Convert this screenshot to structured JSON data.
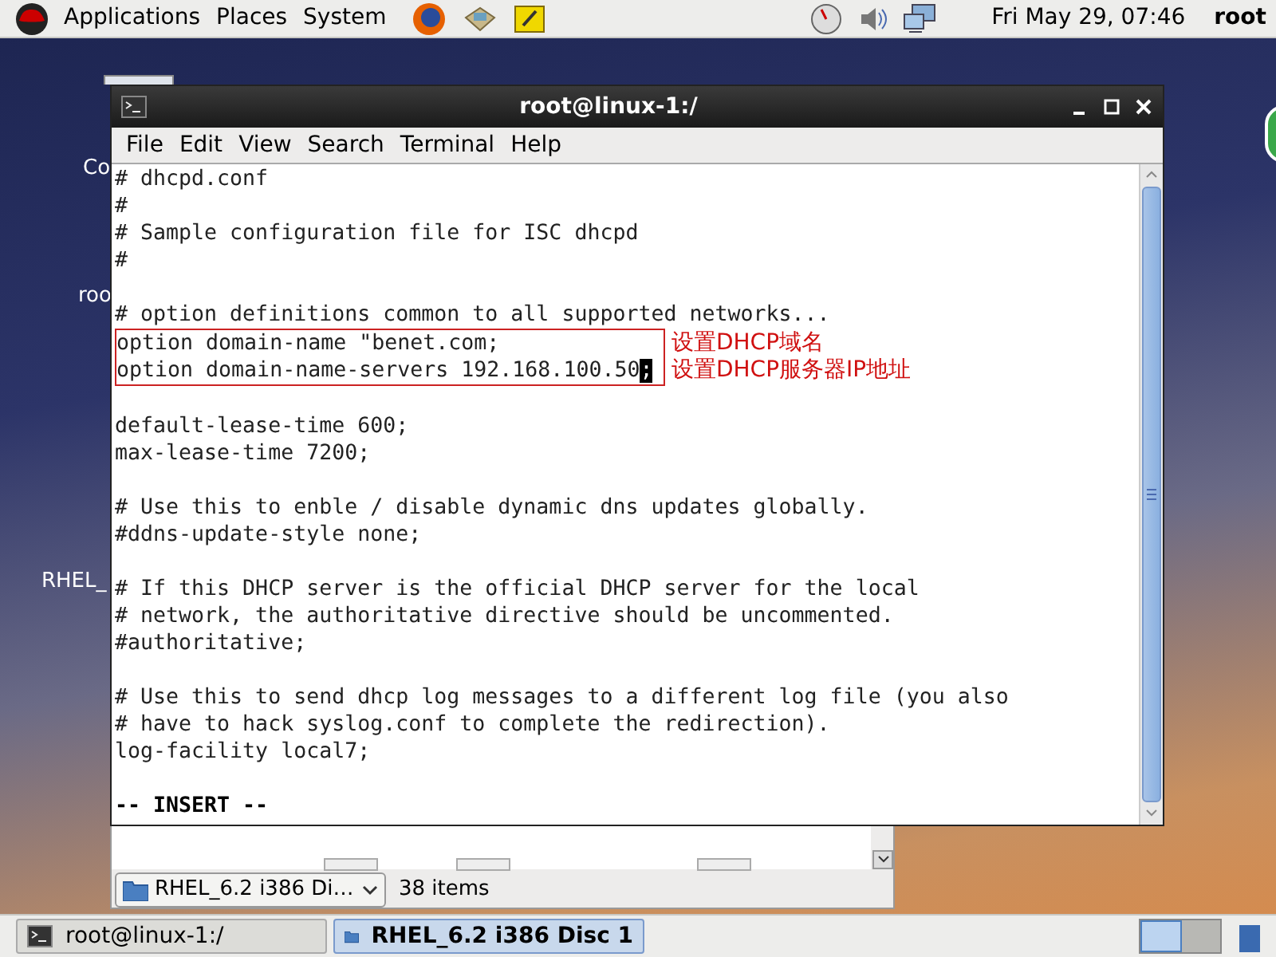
{
  "top_panel": {
    "menus": [
      "Applications",
      "Places",
      "System"
    ],
    "clock": "Fri May 29, 07:46",
    "user": "root"
  },
  "desktop_icons": [
    {
      "label": "Co"
    },
    {
      "label": "roo"
    },
    {
      "label": "RHEL_"
    }
  ],
  "terminal": {
    "title": "root@linux-1:/",
    "menu": [
      "File",
      "Edit",
      "View",
      "Search",
      "Terminal",
      "Help"
    ],
    "blocks": [
      [
        {
          "text": "# dhcpd.conf",
          "highlighted": false
        },
        {
          "text": "#",
          "highlighted": false
        },
        {
          "text": "# Sample configuration file for ISC dhcpd",
          "highlighted": false
        },
        {
          "text": "#",
          "highlighted": false
        }
      ],
      [
        {
          "text": "# option definitions common to all supported networks...",
          "highlighted": false
        },
        {
          "text": "option domain-name \"benet.com;",
          "highlighted": true,
          "note": "设置DHCP域名"
        },
        {
          "text": "option domain-name-servers 192.168.100.50",
          "cursor": ";",
          "highlighted": true,
          "note": "设置DHCP服务器IP地址"
        }
      ],
      [
        {
          "text": "default-lease-time 600;",
          "highlighted": false
        },
        {
          "text": "max-lease-time 7200;",
          "highlighted": false
        }
      ],
      [
        {
          "text": "# Use this to enble / disable dynamic dns updates globally.",
          "highlighted": false
        },
        {
          "text": "#ddns-update-style none;",
          "highlighted": false
        }
      ],
      [
        {
          "text": "# If this DHCP server is the official DHCP server for the local",
          "highlighted": false
        },
        {
          "text": "# network, the authoritative directive should be uncommented.",
          "highlighted": false
        },
        {
          "text": "#authoritative;",
          "highlighted": false
        }
      ],
      [
        {
          "text": "# Use this to send dhcp log messages to a different log file (you also",
          "highlighted": false
        },
        {
          "text": "# have to hack syslog.conf to complete the redirection).",
          "highlighted": false
        },
        {
          "text": "log-facility local7;",
          "highlighted": false
        }
      ]
    ],
    "mode": "-- INSERT --"
  },
  "file_manager": {
    "location": "RHEL_6.2 i386 Di…",
    "status": "38 items"
  },
  "taskbar": [
    {
      "label": "root@linux-1:/",
      "kind": "terminal",
      "selected": false
    },
    {
      "label": "RHEL_6.2 i386 Disc 1",
      "kind": "folder",
      "selected": true
    }
  ]
}
